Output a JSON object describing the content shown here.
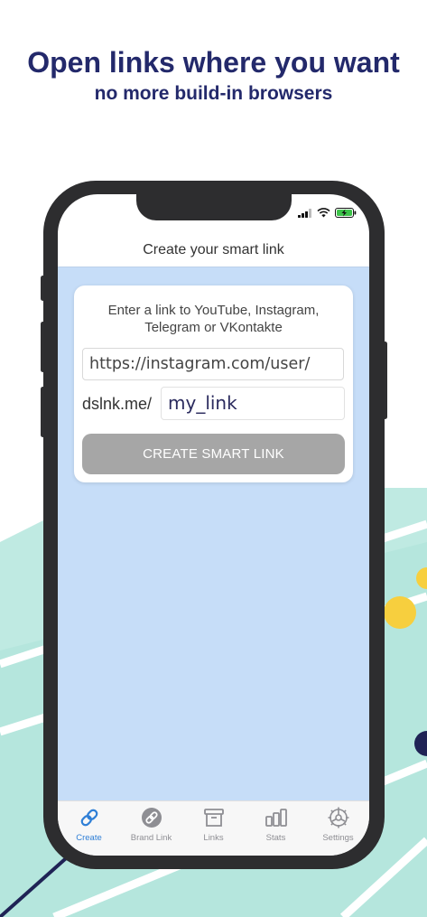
{
  "promo": {
    "headline": "Open links where you want",
    "subline": "no more build-in browsers"
  },
  "colors": {
    "accent": "#2f7fd6",
    "headline": "#23296b",
    "screen_background": "#c6ddf8",
    "button_disabled": "#a6a6a6",
    "deco_mint": "#bfeae2",
    "deco_yellow": "#f7cf3e",
    "deco_navy": "#1f2355"
  },
  "nav": {
    "title": "Create your smart link"
  },
  "form": {
    "instruction": "Enter a link to YouTube, Instagram,\nTelegram or VKontakte",
    "url_value": "https://instagram.com/user/",
    "prefix": "dslnk.me/",
    "slug_value": "my_link",
    "button_label": "CREATE SMART LINK"
  },
  "tabbar": {
    "tabs": [
      {
        "label": "Create",
        "icon": "link-icon",
        "active": true
      },
      {
        "label": "Brand Link",
        "icon": "brand-link-icon",
        "active": false
      },
      {
        "label": "Links",
        "icon": "archive-box-icon",
        "active": false
      },
      {
        "label": "Stats",
        "icon": "bar-chart-icon",
        "active": false
      },
      {
        "label": "Settings",
        "icon": "gear-icon",
        "active": false
      }
    ]
  }
}
